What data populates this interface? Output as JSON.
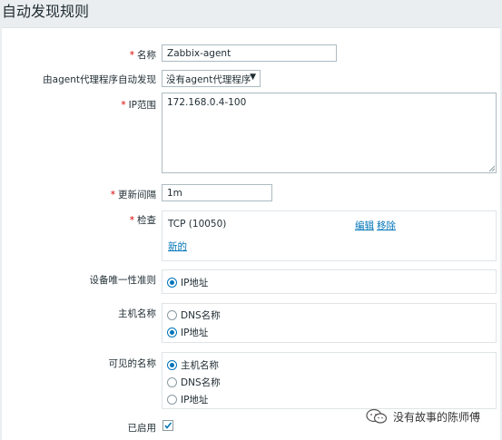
{
  "page": {
    "title": "自动发现规则"
  },
  "fields": {
    "name": {
      "label": "名称",
      "value": "Zabbix-agent"
    },
    "proxy": {
      "label": "由agent代理程序自动发现",
      "selected": "没有agent代理程序"
    },
    "ip_range": {
      "label": "IP范围",
      "value": "172.168.0.4-100"
    },
    "update_interval": {
      "label": "更新间隔",
      "value": "1m"
    },
    "checks": {
      "label": "检查",
      "rows": [
        {
          "name": "TCP (10050)",
          "edit": "编辑",
          "remove": "移除"
        }
      ],
      "new_link": "新的"
    },
    "uniqueness": {
      "label": "设备唯一性准则",
      "options": [
        "IP地址"
      ],
      "selected_index": 0
    },
    "host_name": {
      "label": "主机名称",
      "options": [
        "DNS名称",
        "IP地址"
      ],
      "selected_index": 1
    },
    "visible_name": {
      "label": "可见的名称",
      "options": [
        "主机名称",
        "DNS名称",
        "IP地址"
      ],
      "selected_index": 0
    },
    "enabled": {
      "label": "已启用",
      "checked": true
    }
  },
  "watermark": {
    "text": "没有故事的陈师傅"
  },
  "colors": {
    "link": "#0275b8",
    "required": "#dc0000",
    "border": "#acbbc2",
    "background": "#ebeef0"
  }
}
